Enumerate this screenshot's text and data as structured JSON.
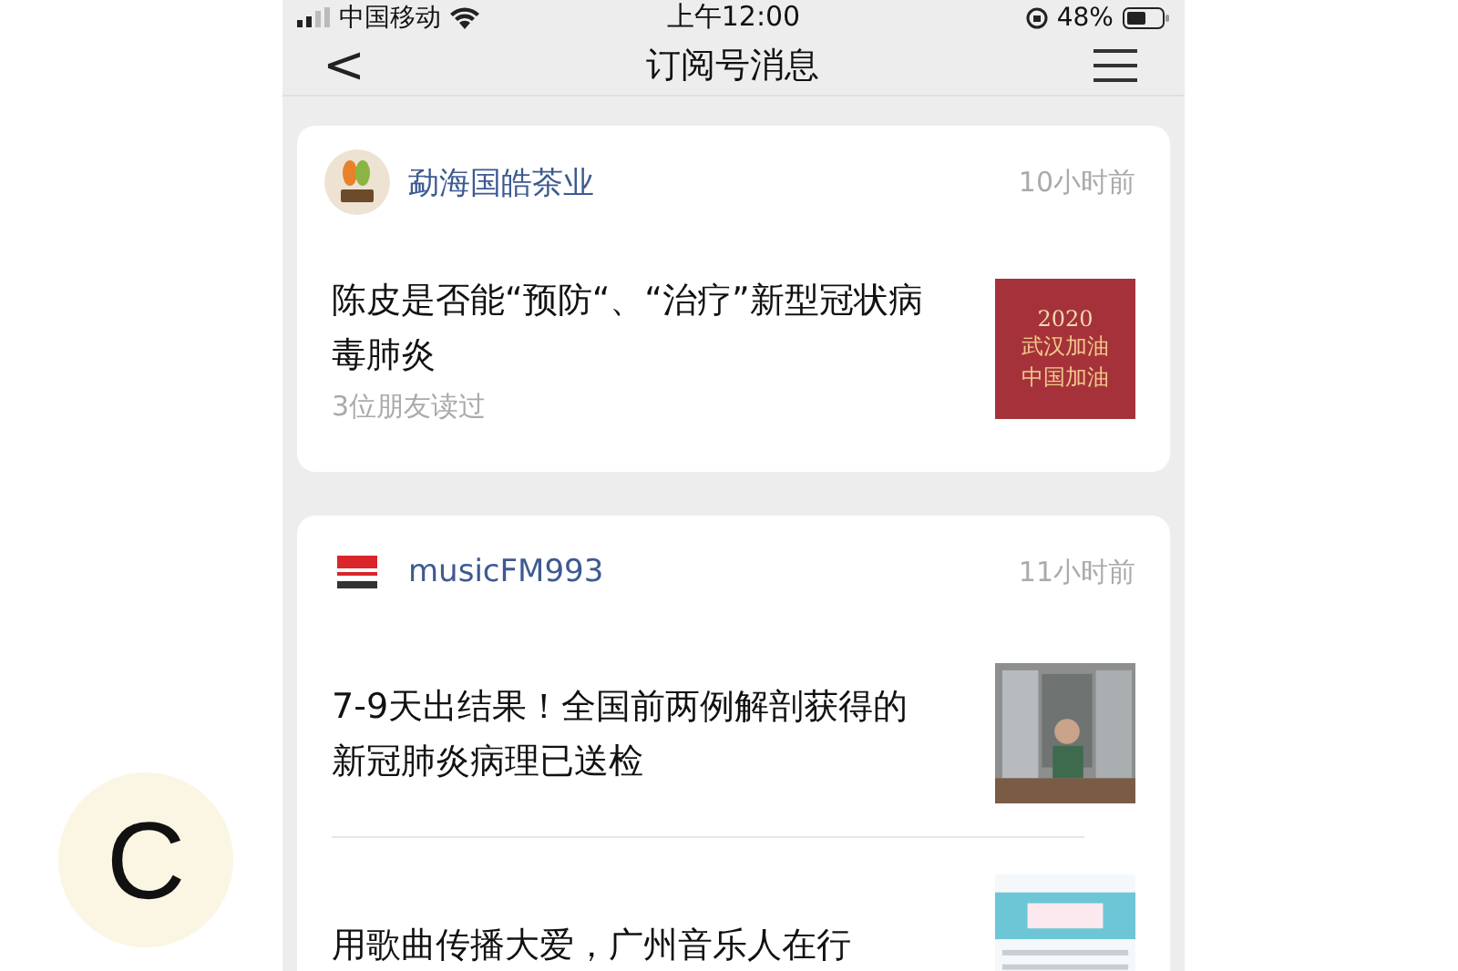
{
  "status_bar": {
    "carrier": "中国移动",
    "time": "上午12:00",
    "battery": "48%"
  },
  "nav": {
    "back": "<",
    "title": "订阅号消息"
  },
  "accounts": [
    {
      "name": "勐海国皓茶业",
      "time": "10小时前",
      "kind": "tea",
      "articles": [
        {
          "title": "陈皮是否能“预防“、“治疗”新型冠状病毒肺炎",
          "meta": "3位朋友读过",
          "thumb": {
            "kind": "banner",
            "lines": [
              "2020",
              "武汉加油",
              "中国加油"
            ]
          }
        }
      ]
    },
    {
      "name": "musicFM993",
      "time": "11小时前",
      "kind": "radio",
      "articles": [
        {
          "title": "7-9天出结果！全国前两例解剖获得的新冠肺炎病理已送检"
        },
        {
          "title": "用歌曲传播大爱，广州音乐人在行"
        }
      ]
    }
  ],
  "panel_label": "C"
}
